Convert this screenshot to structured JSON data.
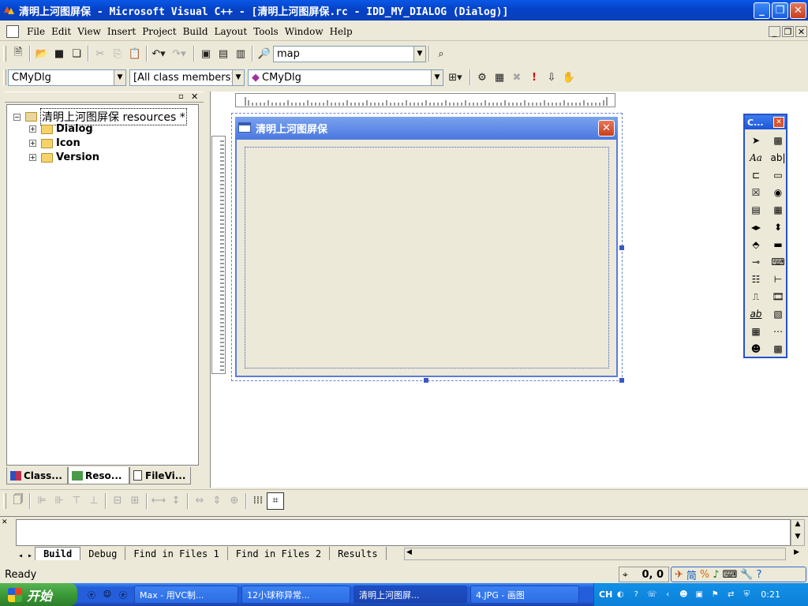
{
  "window": {
    "title": "清明上河图屏保 - Microsoft Visual C++ - [清明上河图屏保.rc - IDD_MY_DIALOG (Dialog)]",
    "min_label": "_",
    "max_label": "❐",
    "close_label": "✕"
  },
  "menu": {
    "items": [
      "File",
      "Edit",
      "View",
      "Insert",
      "Project",
      "Build",
      "Layout",
      "Tools",
      "Window",
      "Help"
    ]
  },
  "toolbar1": {
    "find_combo_value": "map"
  },
  "wizardbar": {
    "class_combo": "CMyDlg",
    "filter_combo": "[All class members]",
    "member_combo": "CMyDlg"
  },
  "workspace": {
    "root_label": "清明上河图屏保 resources *",
    "root_expander": "−",
    "child_expander": "+",
    "folders": [
      "Dialog",
      "Icon",
      "Version"
    ],
    "tabs": [
      "Class...",
      "Reso...",
      "FileVi..."
    ]
  },
  "dialog": {
    "title": "清明上河图屏保",
    "close_label": "✕"
  },
  "palette": {
    "title": "C..."
  },
  "output": {
    "tabs": [
      "Build",
      "Debug",
      "Find in Files 1",
      "Find in Files 2",
      "Results"
    ]
  },
  "status": {
    "text": "Ready",
    "coords": "0, 0"
  },
  "taskbar": {
    "start_label": "开始",
    "tasks": [
      "Max - 用VC制...",
      "12小球称异常...",
      "清明上河图屏...",
      "4.JPG - 画图"
    ],
    "lang": "CH",
    "clock": "0:21"
  },
  "colors": {
    "title_blue": "#0542c8",
    "dialog_title": "#4b78e0",
    "close_red": "#c6401f",
    "face": "#ece9d8"
  }
}
